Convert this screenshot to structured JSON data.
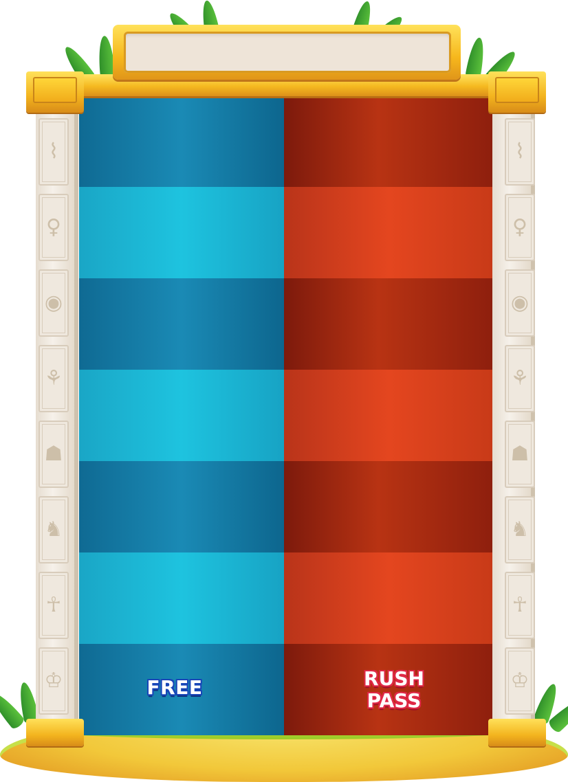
{
  "banner": {
    "text": ""
  },
  "panels": {
    "free": {
      "label": "FREE",
      "color_dark": "#0f6a93",
      "color_light": "#1ec3df",
      "stripe_count": 7
    },
    "rush": {
      "label_line1": "RUSH",
      "label_line2": "PASS",
      "color_dark": "#8e1f0d",
      "color_light": "#e4461f",
      "stripe_count": 7
    }
  },
  "columns": {
    "glyphs": [
      "snake-glyph-icon",
      "anubis-glyph-icon",
      "eye-of-horus-icon",
      "cat-glyph-icon",
      "vase-glyph-icon",
      "sphinx-glyph-icon",
      "ankh-icon",
      "pharaoh-glyph-icon"
    ]
  },
  "colors": {
    "gold": "#f5b920",
    "stone": "#efe8de",
    "sand": "#f2c83a",
    "grass": "#9ccb28"
  }
}
